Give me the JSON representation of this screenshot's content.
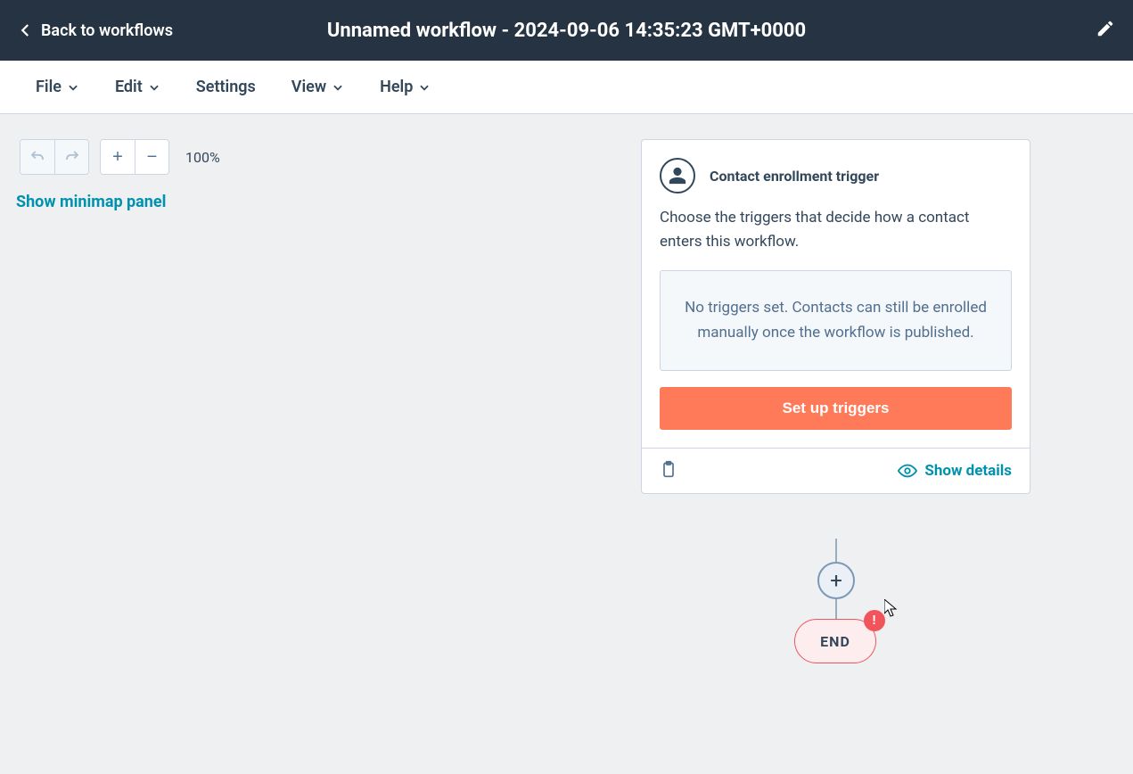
{
  "header": {
    "back_label": "Back to workflows",
    "title": "Unnamed workflow - 2024-09-06 14:35:23 GMT+0000"
  },
  "menu": {
    "file": "File",
    "edit": "Edit",
    "settings": "Settings",
    "view": "View",
    "help": "Help"
  },
  "toolbar": {
    "zoom_level": "100%",
    "minimap_label": "Show minimap panel"
  },
  "trigger_card": {
    "title": "Contact enrollment trigger",
    "description": "Choose the triggers that decide how a contact enters this workflow.",
    "empty_message": "No triggers set. Contacts can still be enrolled manually once the workflow is published.",
    "setup_button": "Set up triggers",
    "details_label": "Show details"
  },
  "end_node": {
    "label": "END",
    "alert": "!"
  }
}
